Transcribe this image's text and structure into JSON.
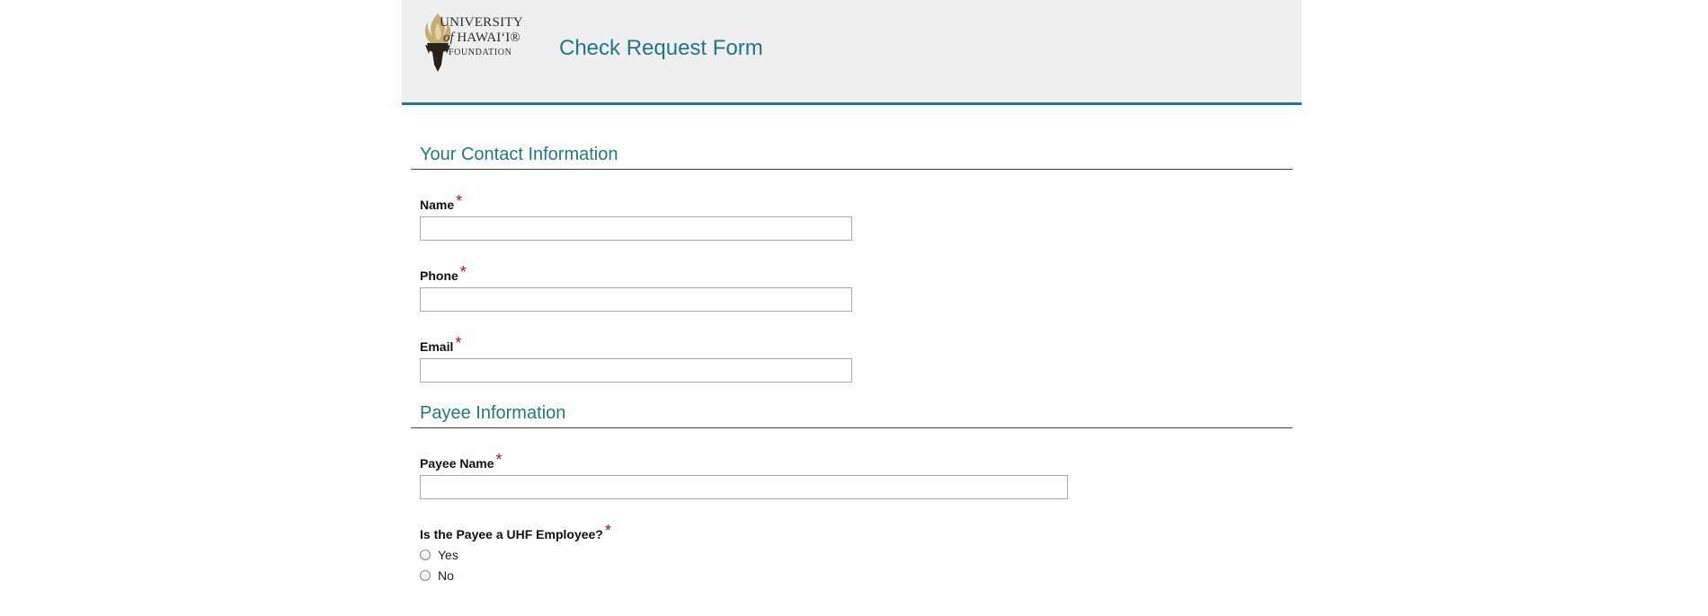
{
  "header": {
    "logo": {
      "line1": "UNIVERSITY",
      "line2_prefix": "of",
      "line2_main": "HAWAI‘I®",
      "line3": "FOUNDATION"
    },
    "title": "Check Request Form"
  },
  "sections": {
    "contact": {
      "title": "Your Contact Information",
      "name_label": "Name",
      "phone_label": "Phone",
      "email_label": "Email"
    },
    "payee": {
      "title": "Payee Information",
      "payee_name_label": "Payee Name",
      "employee_question": "Is the Payee a UHF Employee?",
      "options": [
        "Yes",
        "No"
      ]
    }
  },
  "required_marker": "*",
  "colors": {
    "accent": "#1f7a80",
    "required": "#b5101c",
    "header_bg": "#efeff1"
  }
}
